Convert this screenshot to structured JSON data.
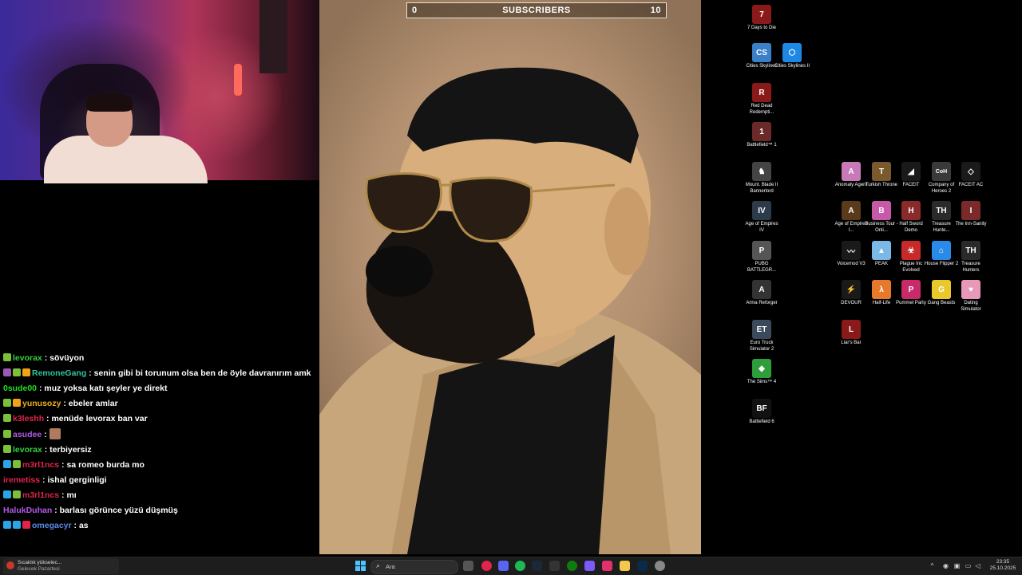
{
  "overlay": {
    "sub_left": "0",
    "sub_title": "SUBSCRIBERS",
    "sub_right": "10"
  },
  "chat": [
    {
      "user": "levorax",
      "color": "#35d23a",
      "msg": "sövüyon",
      "badges": [
        "#7bbf3a"
      ]
    },
    {
      "user": "RemoneGang",
      "color": "#2ec4a0",
      "msg": "senin gibi bi torunum olsa ben de öyle davranırım amk",
      "badges": [
        "#9b59b6",
        "#7bbf3a",
        "#f1a11a"
      ]
    },
    {
      "user": "0sude00",
      "color": "#1ee01e",
      "msg": "muz yoksa katı şeyler ye direkt",
      "badges": []
    },
    {
      "user": "yunusozy",
      "color": "#e8b020",
      "msg": "ebeler amlar",
      "badges": [
        "#7bbf3a",
        "#f1a11a"
      ]
    },
    {
      "user": "k3leshh",
      "color": "#e0244a",
      "msg": "menüde levorax ban var",
      "badges": [
        "#7bbf3a"
      ]
    },
    {
      "user": "asudee",
      "color": "#b35ae8",
      "msg": "",
      "badges": [
        "#7bbf3a"
      ],
      "emote": true
    },
    {
      "user": "levorax",
      "color": "#35d23a",
      "msg": "terbiyersiz",
      "badges": [
        "#7bbf3a"
      ]
    },
    {
      "user": "m3rl1ncs",
      "color": "#e0244a",
      "msg": "sa romeo burda mo",
      "badges": [
        "#2aa6e8",
        "#7bbf3a"
      ]
    },
    {
      "user": "iremetiss",
      "color": "#e0244a",
      "msg": "ishal gerginligi",
      "badges": []
    },
    {
      "user": "m3rl1ncs",
      "color": "#e0244a",
      "msg": "mı",
      "badges": [
        "#2aa6e8",
        "#7bbf3a"
      ]
    },
    {
      "user": "HalukDuhan",
      "color": "#b35ae8",
      "msg": "barlası görünce yüzü düşmüş",
      "badges": []
    },
    {
      "user": "omegacyr",
      "color": "#5a8ae8",
      "msg": "as",
      "badges": [
        "#2aa6e8",
        "#2aa6e8",
        "#e0244a"
      ]
    }
  ],
  "desktop_icons": [
    {
      "label": "7 Days to Die",
      "tile": "#8a1a1a",
      "glyph": "7"
    },
    {
      "label": "Cities Skylines",
      "tile": "#3a7fc8",
      "glyph": "CS"
    },
    {
      "label": "Cities Skylines II",
      "tile": "#1e88e5",
      "glyph": "⬡"
    },
    {
      "label": "Red Dead Redempti...",
      "tile": "#8a1a1a",
      "glyph": "R"
    },
    {
      "label": "Battlefield™ 1",
      "tile": "#6a2a2a",
      "glyph": "1"
    },
    {
      "label": "Mount. Blade II Bannerlord",
      "tile": "#444",
      "glyph": "♞"
    },
    {
      "label": "Age of Empires IV",
      "tile": "#2c3a4a",
      "glyph": "IV"
    },
    {
      "label": "PUBG BATTLEGR...",
      "tile": "#555",
      "glyph": "P"
    },
    {
      "label": "Arma Reforger",
      "tile": "#333",
      "glyph": "A"
    },
    {
      "label": "Euro Truck Simulator 2",
      "tile": "#3a4a5a",
      "glyph": "ET"
    },
    {
      "label": "The Sims™ 4",
      "tile": "#2e9e3a",
      "glyph": "◆"
    },
    {
      "label": "Battlefield 6",
      "tile": "#111",
      "glyph": "BF"
    },
    {
      "label": "Anomaly Agent",
      "tile": "#c87ab8",
      "glyph": "A"
    },
    {
      "label": "Turkish Throne",
      "tile": "#7a5a2a",
      "glyph": "T"
    },
    {
      "label": "FACEIT",
      "tile": "#1a1a1a",
      "glyph": "◢"
    },
    {
      "label": "Company of Heroes 2",
      "tile": "#3a3a3a",
      "glyph": "CoH"
    },
    {
      "label": "FACEIT AC",
      "tile": "#1a1a1a",
      "glyph": "◇"
    },
    {
      "label": "Age of Empires I...",
      "tile": "#5a3a1a",
      "glyph": "A"
    },
    {
      "label": "Business Tour - Onli...",
      "tile": "#c858a8",
      "glyph": "B"
    },
    {
      "label": "Half Sword Demo",
      "tile": "#8a2a2a",
      "glyph": "H"
    },
    {
      "label": "Treasure Hunte...",
      "tile": "#2a2a2a",
      "glyph": "TH"
    },
    {
      "label": "The Inn-Sanity",
      "tile": "#7a2a2a",
      "glyph": "I"
    },
    {
      "label": "Voicemod V3",
      "tile": "#1a1a1a",
      "glyph": "〰"
    },
    {
      "label": "PEAK",
      "tile": "#7ab8e8",
      "glyph": "▲"
    },
    {
      "label": "Plague Inc Evolved",
      "tile": "#c82a2a",
      "glyph": "☣"
    },
    {
      "label": "House Flipper 2",
      "tile": "#2a8ae8",
      "glyph": "⌂"
    },
    {
      "label": "Treasure Hunters",
      "tile": "#2a2a2a",
      "glyph": "TH"
    },
    {
      "label": "DEVOUR",
      "tile": "#1a1a1a",
      "glyph": "⚡"
    },
    {
      "label": "Half-Life",
      "tile": "#e8782a",
      "glyph": "λ"
    },
    {
      "label": "Pummel Party",
      "tile": "#c82a6a",
      "glyph": "P"
    },
    {
      "label": "Gang Beasts",
      "tile": "#e8c82a",
      "glyph": "G"
    },
    {
      "label": "Dating Simulator",
      "tile": "#e898b8",
      "glyph": "♥"
    },
    {
      "label": "Liar's Bar",
      "tile": "#8a1a1a",
      "glyph": "L"
    }
  ],
  "taskbar": {
    "weather_line1": "Sıcaklık yükselec...",
    "weather_line2": "Gelecek Pazartesi",
    "search_placeholder": "Ara",
    "clock_time": "23:35",
    "clock_date": "25.10.2025"
  }
}
